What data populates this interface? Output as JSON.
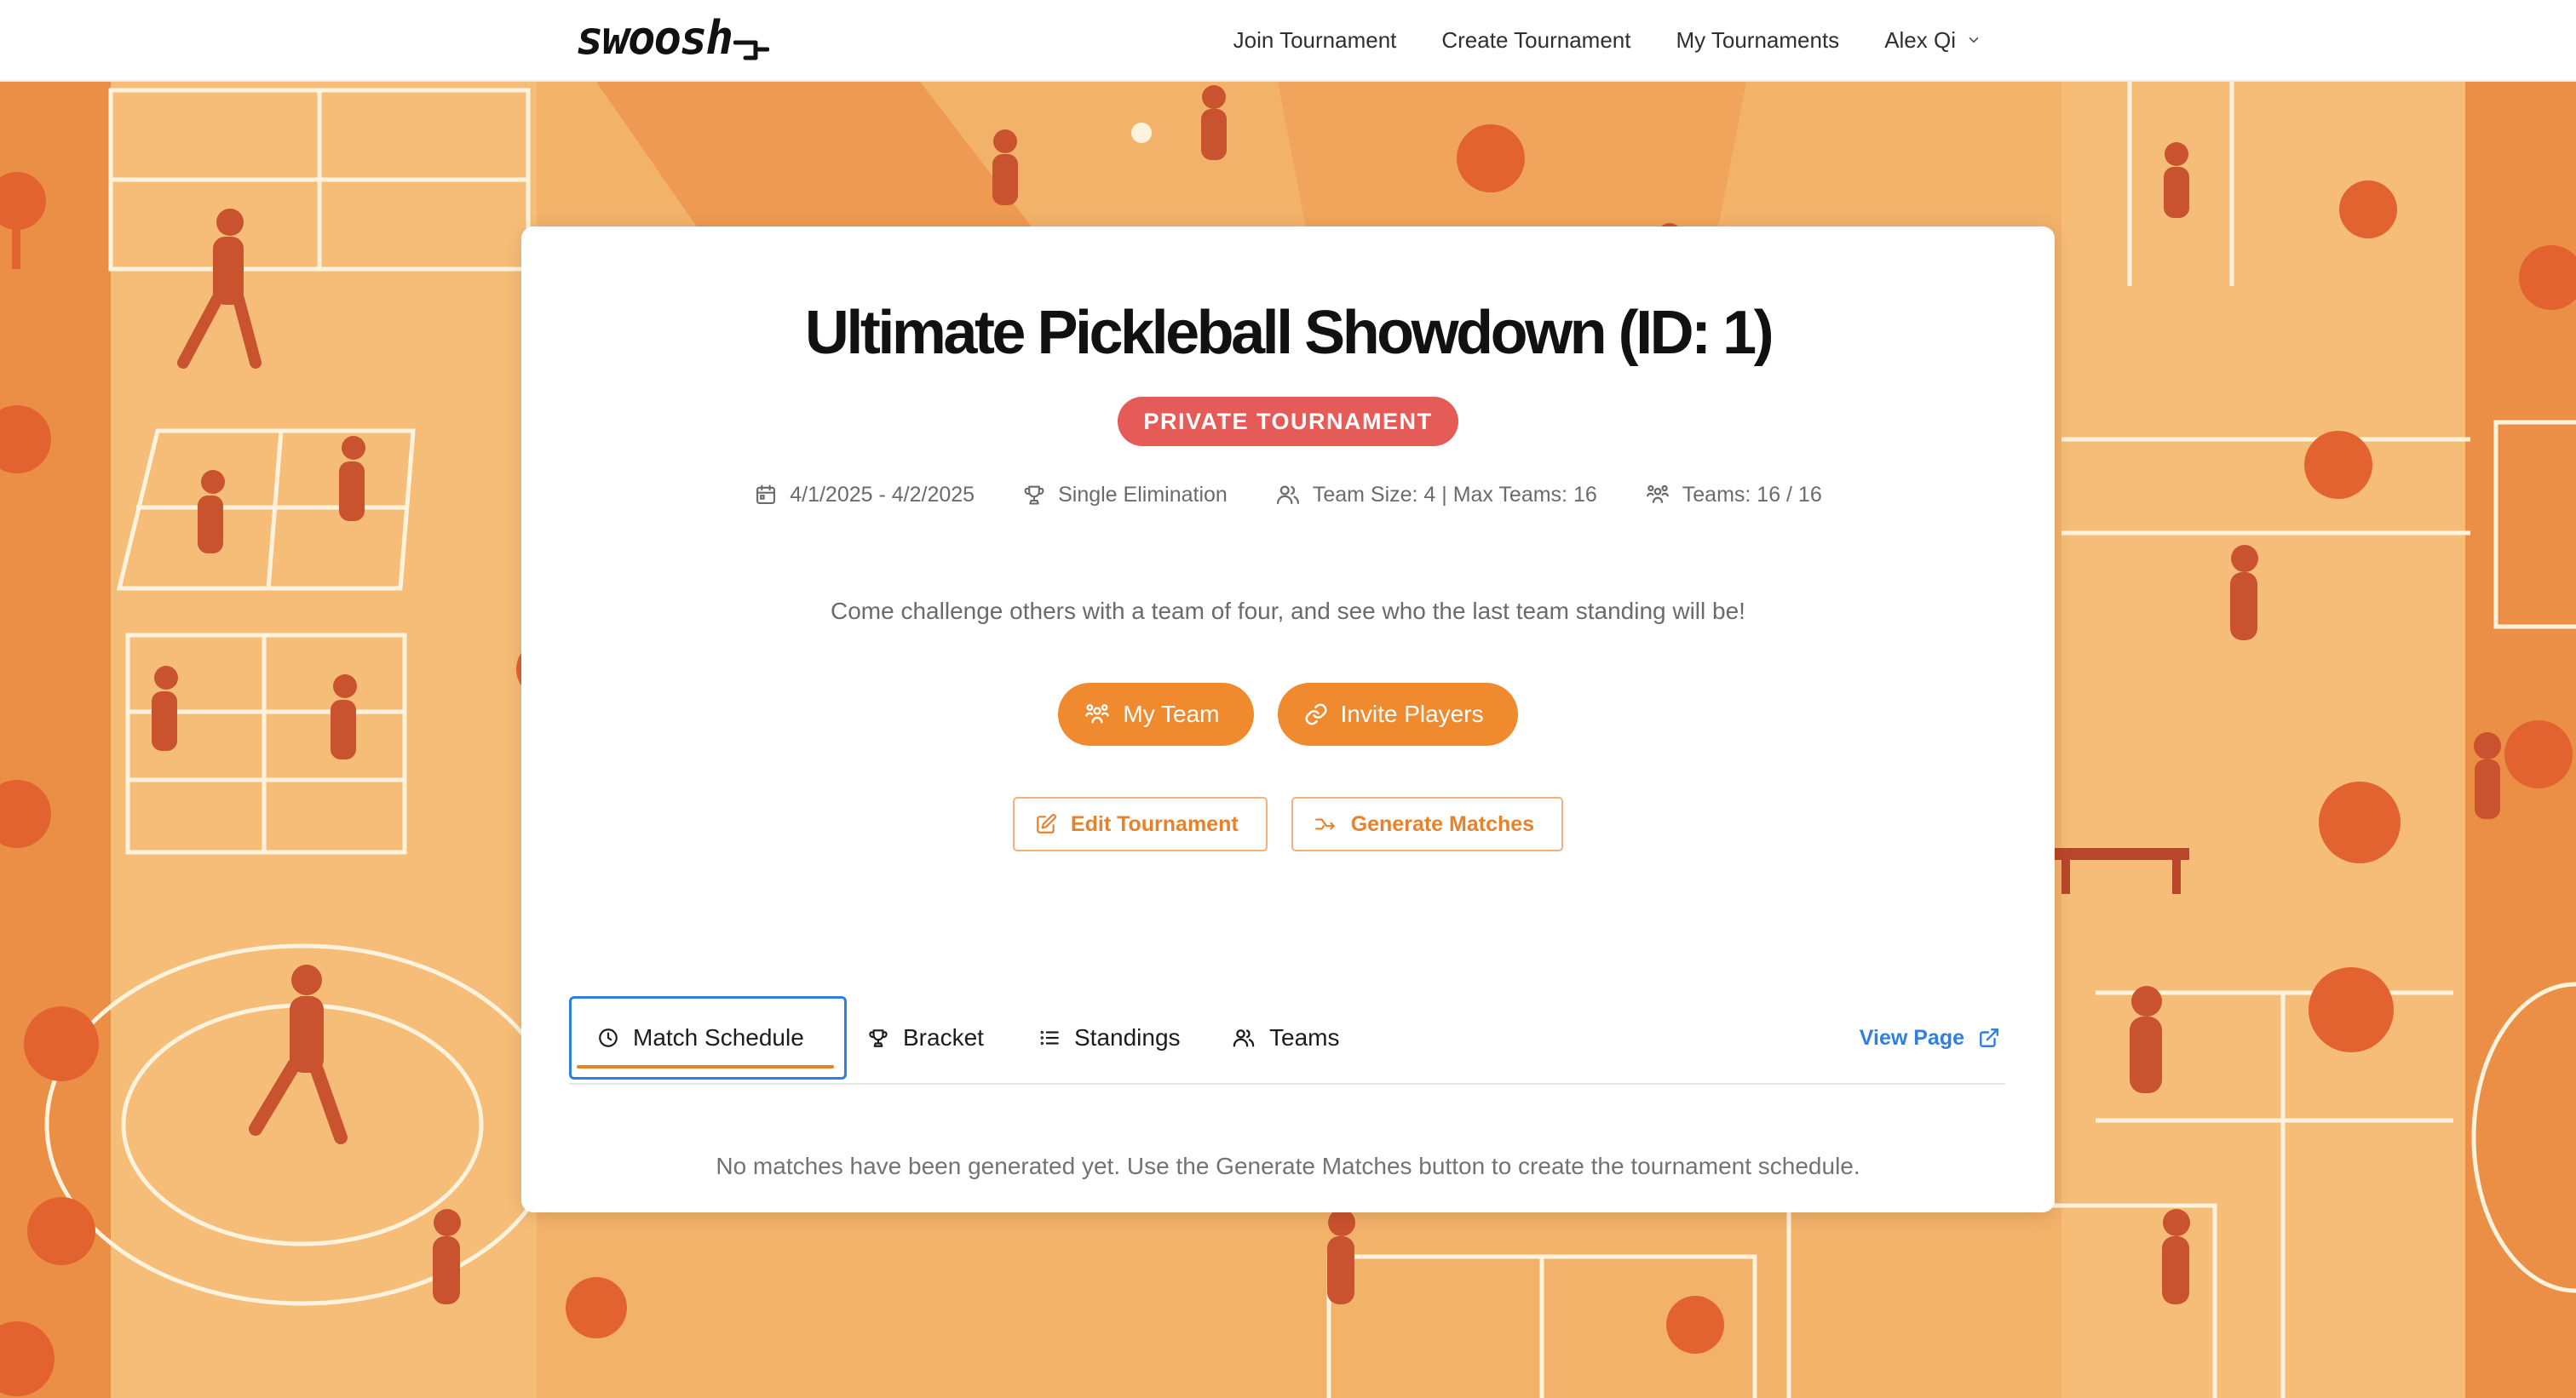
{
  "brand": {
    "logo_text": "swoosh"
  },
  "nav": {
    "links": [
      "Join Tournament",
      "Create Tournament",
      "My Tournaments"
    ],
    "user_name": "Alex Qi"
  },
  "tournament": {
    "title": "Ultimate Pickleball Showdown (ID: 1)",
    "badge": "PRIVATE TOURNAMENT",
    "dates": "4/1/2025 - 4/2/2025",
    "format": "Single Elimination",
    "team_info": "Team Size: 4 | Max Teams: 16",
    "teams_count": "Teams: 16 / 16",
    "description": "Come challenge others with a team of four, and see who the last team standing will be!"
  },
  "actions": {
    "my_team": "My Team",
    "invite_players": "Invite Players",
    "edit_tournament": "Edit Tournament",
    "generate_matches": "Generate Matches"
  },
  "tabs": {
    "match_schedule": "Match Schedule",
    "bracket": "Bracket",
    "standings": "Standings",
    "teams": "Teams",
    "view_page": "View Page",
    "active": "Match Schedule"
  },
  "empty_state": "No matches have been generated yet. Use the Generate Matches button to create the tournament schedule.",
  "colors": {
    "accent": "#ef8a2e",
    "badge": "#e45b58",
    "link": "#2f7fe0",
    "background": "#f4b36a"
  },
  "icons": {
    "dates": "calendar-icon",
    "format": "trophy-icon",
    "team_info": "users-icon",
    "teams_count": "team-group-icon",
    "my_team": "team-group-icon",
    "invite": "link-icon",
    "edit": "edit-icon",
    "generate": "shuffle-icon",
    "schedule": "clock-icon",
    "bracket": "trophy-icon",
    "standings": "list-icon",
    "teams": "users-icon",
    "view_page": "external-link-icon",
    "user_menu": "chevron-down-icon"
  }
}
